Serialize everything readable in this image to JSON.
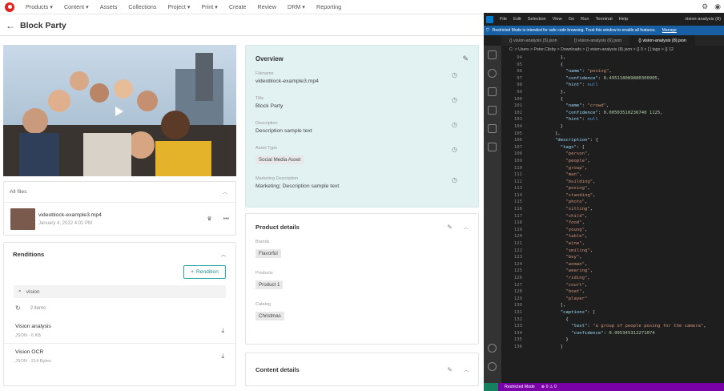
{
  "nav": {
    "items": [
      "Products ▾",
      "Content ▾",
      "Assets",
      "Collections",
      "Project ▾",
      "Print ▾",
      "Create",
      "Review",
      "DRM ▾",
      "Reporting"
    ]
  },
  "page": {
    "title": "Block Party",
    "back": "←"
  },
  "files": {
    "header": "All files",
    "name": "videoblock-example3.mp4",
    "date": "January 4, 2022 4:01 PM"
  },
  "renditions": {
    "title": "Renditions",
    "add_label": "Rendition",
    "search_value": "vision",
    "count": "2 items",
    "items": [
      {
        "name": "Vision analysis",
        "meta": "JSON · 6 KB"
      },
      {
        "name": "Vision OCR",
        "meta": "JSON · 214 Bytes"
      }
    ]
  },
  "overview": {
    "title": "Overview",
    "fields": [
      {
        "label": "Filename",
        "value": "videoblock-example3.mp4"
      },
      {
        "label": "Title",
        "value": "Block Party"
      },
      {
        "label": "Description",
        "value": "Description sample text"
      },
      {
        "label": "Asset Type",
        "value": "Social Media Asset"
      },
      {
        "label": "Marketing Description",
        "value": "Marketing; Description sample text"
      }
    ]
  },
  "product": {
    "title": "Product details",
    "fields": [
      {
        "label": "Brands",
        "value": "Flavorful"
      },
      {
        "label": "Products",
        "value": "Product 1"
      },
      {
        "label": "Catalog",
        "value": "Christmas"
      }
    ]
  },
  "content_details": {
    "title": "Content details"
  },
  "vscode": {
    "menu": [
      "File",
      "Edit",
      "Selection",
      "View",
      "Go",
      "Run",
      "Terminal",
      "Help"
    ],
    "window_title": "vision-analysis (8)",
    "restricted_text": "Restricted Mode is intended for safe code browsing. Trust this window to enable all features.",
    "manage": "Manage",
    "tabs": [
      "{} vision-analysis (5).json",
      "{} vision-analysis (6).json",
      "{} vision-analysis (8).json"
    ],
    "breadcrumb": "C: > Users > Peter.Clisby > Downloads > {} vision-analysis (8).json > {} 0 > [ ] tags > {} 12",
    "status_mode": "Restricted Mode",
    "status_counts": "⊗ 0 ⚠ 0",
    "lines": [
      [
        "94",
        "          },"
      ],
      [
        "95",
        "          {"
      ],
      [
        "96",
        "            \"name\": \"posing\","
      ],
      [
        "97",
        "            \"confidence\": 0.495118089880300905,"
      ],
      [
        "98",
        "            \"hint\": null"
      ],
      [
        "99",
        "          },"
      ],
      [
        "100",
        "          {"
      ],
      [
        "101",
        "            \"name\": \"crowd\","
      ],
      [
        "102",
        "            \"confidence\": 0.00503510236740 1125,"
      ],
      [
        "103",
        "            \"hint\": null"
      ],
      [
        "104",
        "          }"
      ],
      [
        "105",
        "        ],"
      ],
      [
        "106",
        "        \"description\": {"
      ],
      [
        "107",
        "          \"tags\": ["
      ],
      [
        "108",
        "            \"person\","
      ],
      [
        "109",
        "            \"people\","
      ],
      [
        "110",
        "            \"group\","
      ],
      [
        "111",
        "            \"man\","
      ],
      [
        "112",
        "            \"building\","
      ],
      [
        "113",
        "            \"posing\","
      ],
      [
        "114",
        "            \"standing\","
      ],
      [
        "115",
        "            \"photo\","
      ],
      [
        "116",
        "            \"sitting\","
      ],
      [
        "117",
        "            \"child\","
      ],
      [
        "118",
        "            \"food\","
      ],
      [
        "119",
        "            \"young\","
      ],
      [
        "120",
        "            \"table\","
      ],
      [
        "121",
        "            \"wine\","
      ],
      [
        "122",
        "            \"smiling\","
      ],
      [
        "123",
        "            \"boy\","
      ],
      [
        "124",
        "            \"woman\","
      ],
      [
        "125",
        "            \"wearing\","
      ],
      [
        "126",
        "            \"riding\","
      ],
      [
        "127",
        "            \"court\","
      ],
      [
        "128",
        "            \"boat\","
      ],
      [
        "129",
        "            \"player\""
      ],
      [
        "130",
        "          ],"
      ],
      [
        "131",
        "          \"captions\": ["
      ],
      [
        "132",
        "            {"
      ],
      [
        "133",
        "              \"text\": \"a group of people posing for the camera\","
      ],
      [
        "134",
        "              \"confidence\": 0.995345312271074"
      ],
      [
        "135",
        "            }"
      ],
      [
        "136",
        "          ]"
      ]
    ]
  }
}
